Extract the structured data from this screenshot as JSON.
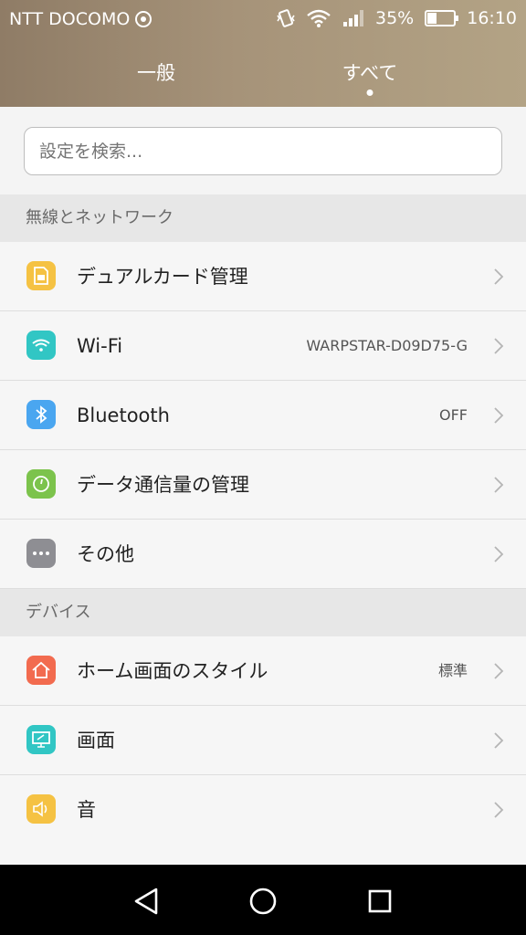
{
  "status_bar": {
    "carrier": "NTT DOCOMO",
    "battery_percent": "35%",
    "battery_level": 0.35,
    "time": "16:10",
    "icons": [
      "vibrate-icon",
      "wifi-icon",
      "signal-icon",
      "battery-icon"
    ]
  },
  "tabs": [
    {
      "label": "一般",
      "selected": false
    },
    {
      "label": "すべて",
      "selected": true
    }
  ],
  "search": {
    "placeholder": "設定を検索..."
  },
  "sections": [
    {
      "header": "無線とネットワーク",
      "items": [
        {
          "label": "デュアルカード管理",
          "value": "",
          "icon": "sim-card-icon",
          "color": "#f5c243"
        },
        {
          "label": "Wi-Fi",
          "value": "WARPSTAR-D09D75-G",
          "icon": "wifi-icon",
          "color": "#31c6c4"
        },
        {
          "label": "Bluetooth",
          "value": "OFF",
          "icon": "bluetooth-icon",
          "color": "#4aa6f0"
        },
        {
          "label": "データ通信量の管理",
          "value": "",
          "icon": "data-usage-icon",
          "color": "#7cc34c"
        },
        {
          "label": "その他",
          "value": "",
          "icon": "more-icon",
          "color": "#8e8e93"
        }
      ]
    },
    {
      "header": "デバイス",
      "items": [
        {
          "label": "ホーム画面のスタイル",
          "value": "標準",
          "icon": "home-icon",
          "color": "#f26b4f"
        },
        {
          "label": "画面",
          "value": "",
          "icon": "display-icon",
          "color": "#31c6c4"
        },
        {
          "label": "音",
          "value": "",
          "icon": "sound-icon",
          "color": "#f5c243"
        }
      ]
    }
  ],
  "nav_bar": {
    "buttons": [
      "back-icon",
      "home-circle-icon",
      "recents-icon"
    ]
  }
}
